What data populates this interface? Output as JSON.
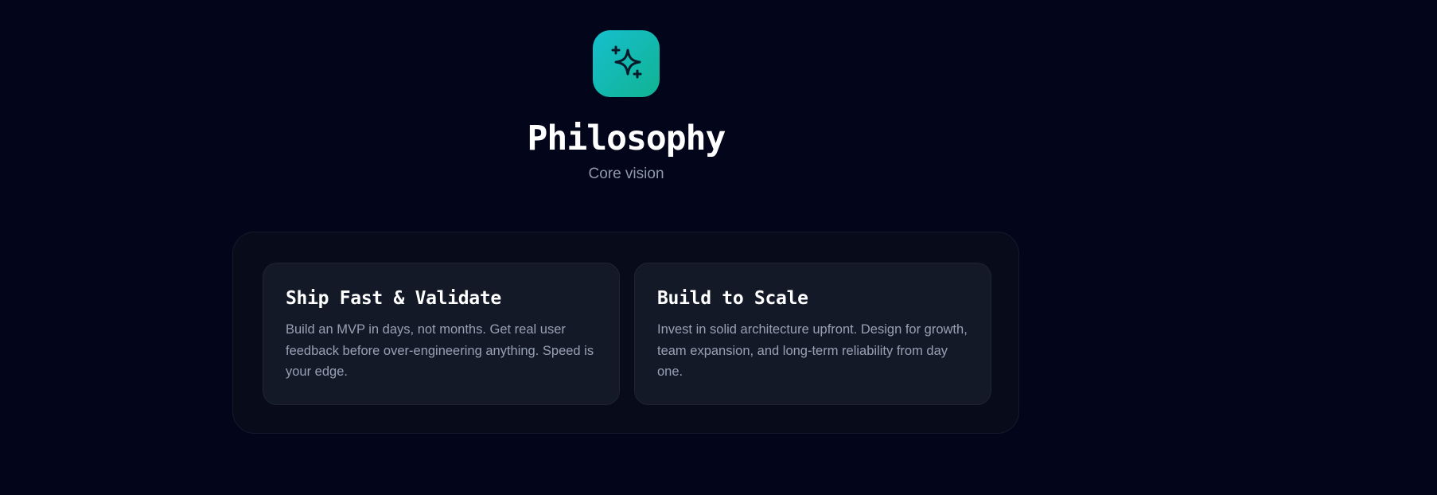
{
  "header": {
    "icon": "sparkles-icon",
    "title": "Philosophy",
    "subtitle": "Core vision"
  },
  "colors": {
    "background": "#03061a",
    "accent_gradient_start": "#16bfce",
    "accent_gradient_end": "#11b392",
    "card_background": "#131927",
    "muted_text": "#98a1b4"
  },
  "cards": [
    {
      "title": "Ship Fast & Validate",
      "text": "Build an MVP in days, not months. Get real user feedback before over-engineering anything. Speed is your edge."
    },
    {
      "title": "Build to Scale",
      "text": "Invest in solid architecture upfront. Design for growth, team expansion, and long-term reliability from day one."
    }
  ]
}
